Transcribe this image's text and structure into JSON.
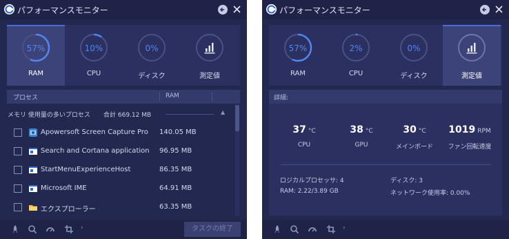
{
  "colors": {
    "panel_bg": "#232851",
    "accent": "#4f86f0",
    "titlebar_bg": "#1e2347",
    "tile_active_bg": "#3c4378"
  },
  "left": {
    "title": "パフォーマンスモニター",
    "icons": {
      "logo": "app-logo-icon",
      "back": "arrow-left-icon",
      "close": "close-icon"
    },
    "gauges": [
      {
        "value": "57%",
        "label": "RAM",
        "percent": 57,
        "active": true
      },
      {
        "value": "10%",
        "label": "CPU",
        "percent": 10,
        "active": false
      },
      {
        "value": "0%",
        "label": "ディスク",
        "percent": 0,
        "active": false
      },
      {
        "icon": "bar-chart-icon",
        "label": "測定値",
        "active": false
      }
    ],
    "list_header": {
      "process": "プロセス",
      "ram": "RAM"
    },
    "group": {
      "label": "メモリ 使用量の多いプロセス",
      "total": "合計 669.12 MB"
    },
    "processes": [
      {
        "name": "Apowersoft Screen Capture Pro",
        "ram": "140.05 MB",
        "icon": "app-icon"
      },
      {
        "name": "Search and Cortana application",
        "ram": "96.95 MB",
        "icon": "window-icon"
      },
      {
        "name": "StartMenuExperienceHost",
        "ram": "86.35 MB",
        "icon": "window-icon"
      },
      {
        "name": "Microsoft IME",
        "ram": "64.91 MB",
        "icon": "window-icon"
      },
      {
        "name": "エクスプローラー",
        "ram": "63.35 MB",
        "icon": "folder-icon"
      }
    ],
    "bottom": {
      "end_task": "タスクの終了",
      "more": "›"
    }
  },
  "right": {
    "title": "パフォーマンスモニター",
    "gauges": [
      {
        "value": "57%",
        "label": "RAM",
        "percent": 57,
        "active": false
      },
      {
        "value": "2%",
        "label": "CPU",
        "percent": 2,
        "active": false
      },
      {
        "value": "0%",
        "label": "ディスク",
        "percent": 0,
        "active": false
      },
      {
        "icon": "bar-chart-icon",
        "label": "測定値",
        "active": true
      }
    ],
    "details_label": "詳細:",
    "metrics": [
      {
        "value": "37",
        "unit": "°C",
        "label": "CPU"
      },
      {
        "value": "38",
        "unit": "°C",
        "label": "GPU"
      },
      {
        "value": "30",
        "unit": "°C",
        "label": "メインボード"
      },
      {
        "value": "1019",
        "unit": "RPM",
        "label": "ファン回転速度"
      }
    ],
    "info": {
      "logical_processors": "ロジカルプロセッサ: 4",
      "ram": "RAM: 2.22/3.89 GB",
      "disk": "ディスク: 3",
      "network": "ネットワーク使用率: 0.00%"
    },
    "bottom": {
      "more": "›"
    }
  }
}
